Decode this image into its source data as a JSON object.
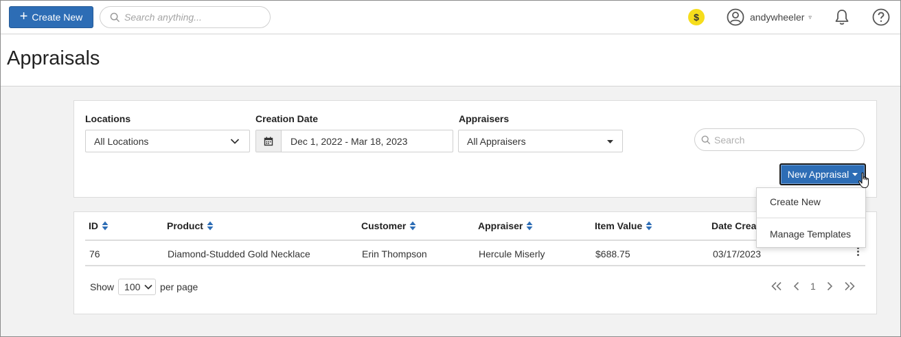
{
  "topbar": {
    "create_label": "Create New",
    "search_placeholder": "Search anything...",
    "coin_symbol": "$",
    "username": "andywheeler",
    "user_caret": "▿"
  },
  "header": {
    "title": "Appraisals"
  },
  "filters": {
    "locations_label": "Locations",
    "locations_value": "All Locations",
    "creation_date_label": "Creation Date",
    "creation_date_value": "Dec 1, 2022 - Mar 18, 2023",
    "appraisers_label": "Appraisers",
    "appraisers_value": "All Appraisers",
    "search_placeholder": "Search",
    "new_appraisal_label": "New Appraisal"
  },
  "dropdown": {
    "items": [
      {
        "label": "Create New"
      },
      {
        "label": "Manage Templates"
      }
    ]
  },
  "table": {
    "columns": [
      "ID",
      "Product",
      "Customer",
      "Appraiser",
      "Item Value",
      "Date Creat"
    ],
    "rows": [
      {
        "id": "76",
        "product": "Diamond-Studded Gold Necklace",
        "customer": "Erin Thompson",
        "appraiser": "Hercule Miserly",
        "item_value": "$688.75",
        "date_created": "03/17/2023"
      }
    ]
  },
  "pagination": {
    "show_label": "Show",
    "per_page_value": "100",
    "per_page_label": "per page",
    "current_page": "1"
  },
  "colors": {
    "primary": "#2d6db5",
    "coin": "#f6dd1c",
    "sort_icon": "#2d6db5"
  }
}
